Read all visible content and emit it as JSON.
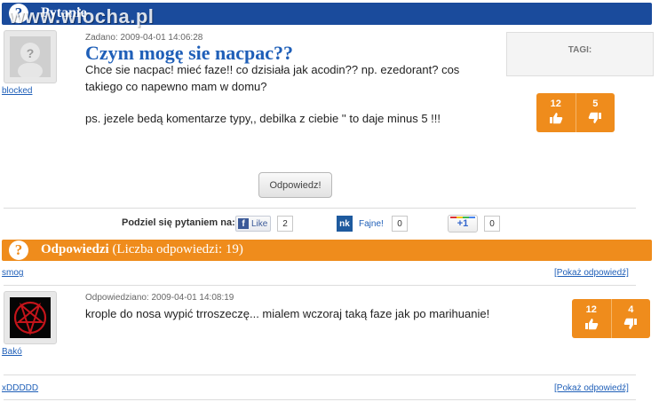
{
  "header": {
    "title": "Pytanie",
    "watermark": "www.wiocha.pl"
  },
  "question": {
    "meta": "Zadano: 2009-04-01 14:06:28",
    "title": "Czym mogę sie nacpac??",
    "body_line1": "Chce sie nacpac! mieć faze!! co dzisiała jak acodin?? np. ezedorant? cos",
    "body_line2": "takiego co napewno mam w domu?",
    "body_line3": "ps. jezele bedą komentarze typy,, debilka z ciebie '' to daje minus 5 !!!",
    "author": "blocked",
    "votes_up": "12",
    "votes_down": "5"
  },
  "tags": {
    "label": "TAGI:"
  },
  "answer_button": {
    "label": "Odpowiedz!"
  },
  "share": {
    "label": "Podziel się pytaniem na:",
    "fb_like": "Like",
    "fb_count": "2",
    "nk_logo": "nk",
    "nk_label": "Fajne!",
    "nk_count": "0",
    "gplus_label": "+1",
    "gplus_count": "0"
  },
  "answers_header": {
    "title": "Odpowiedzi",
    "count_text": "(Liczba odpowiedzi: 19)"
  },
  "answers": [
    {
      "commenter": "smog",
      "show_link": "[Pokaż odpowiedź]"
    },
    {
      "meta": "Odpowiedziano: 2009-04-01 14:08:19",
      "body": "krople do nosa wypić trroszeczę... mialem wczoraj taką faze jak po marihuanie!",
      "author": "Bakó",
      "votes_up": "12",
      "votes_down": "4"
    },
    {
      "commenter": "xDDDDD",
      "show_link": "[Pokaż odpowiedź]"
    }
  ],
  "colors": {
    "header_blue": "#1a4b9c",
    "accent_orange": "#ef8c1c",
    "link_blue": "#1f5fb8"
  }
}
